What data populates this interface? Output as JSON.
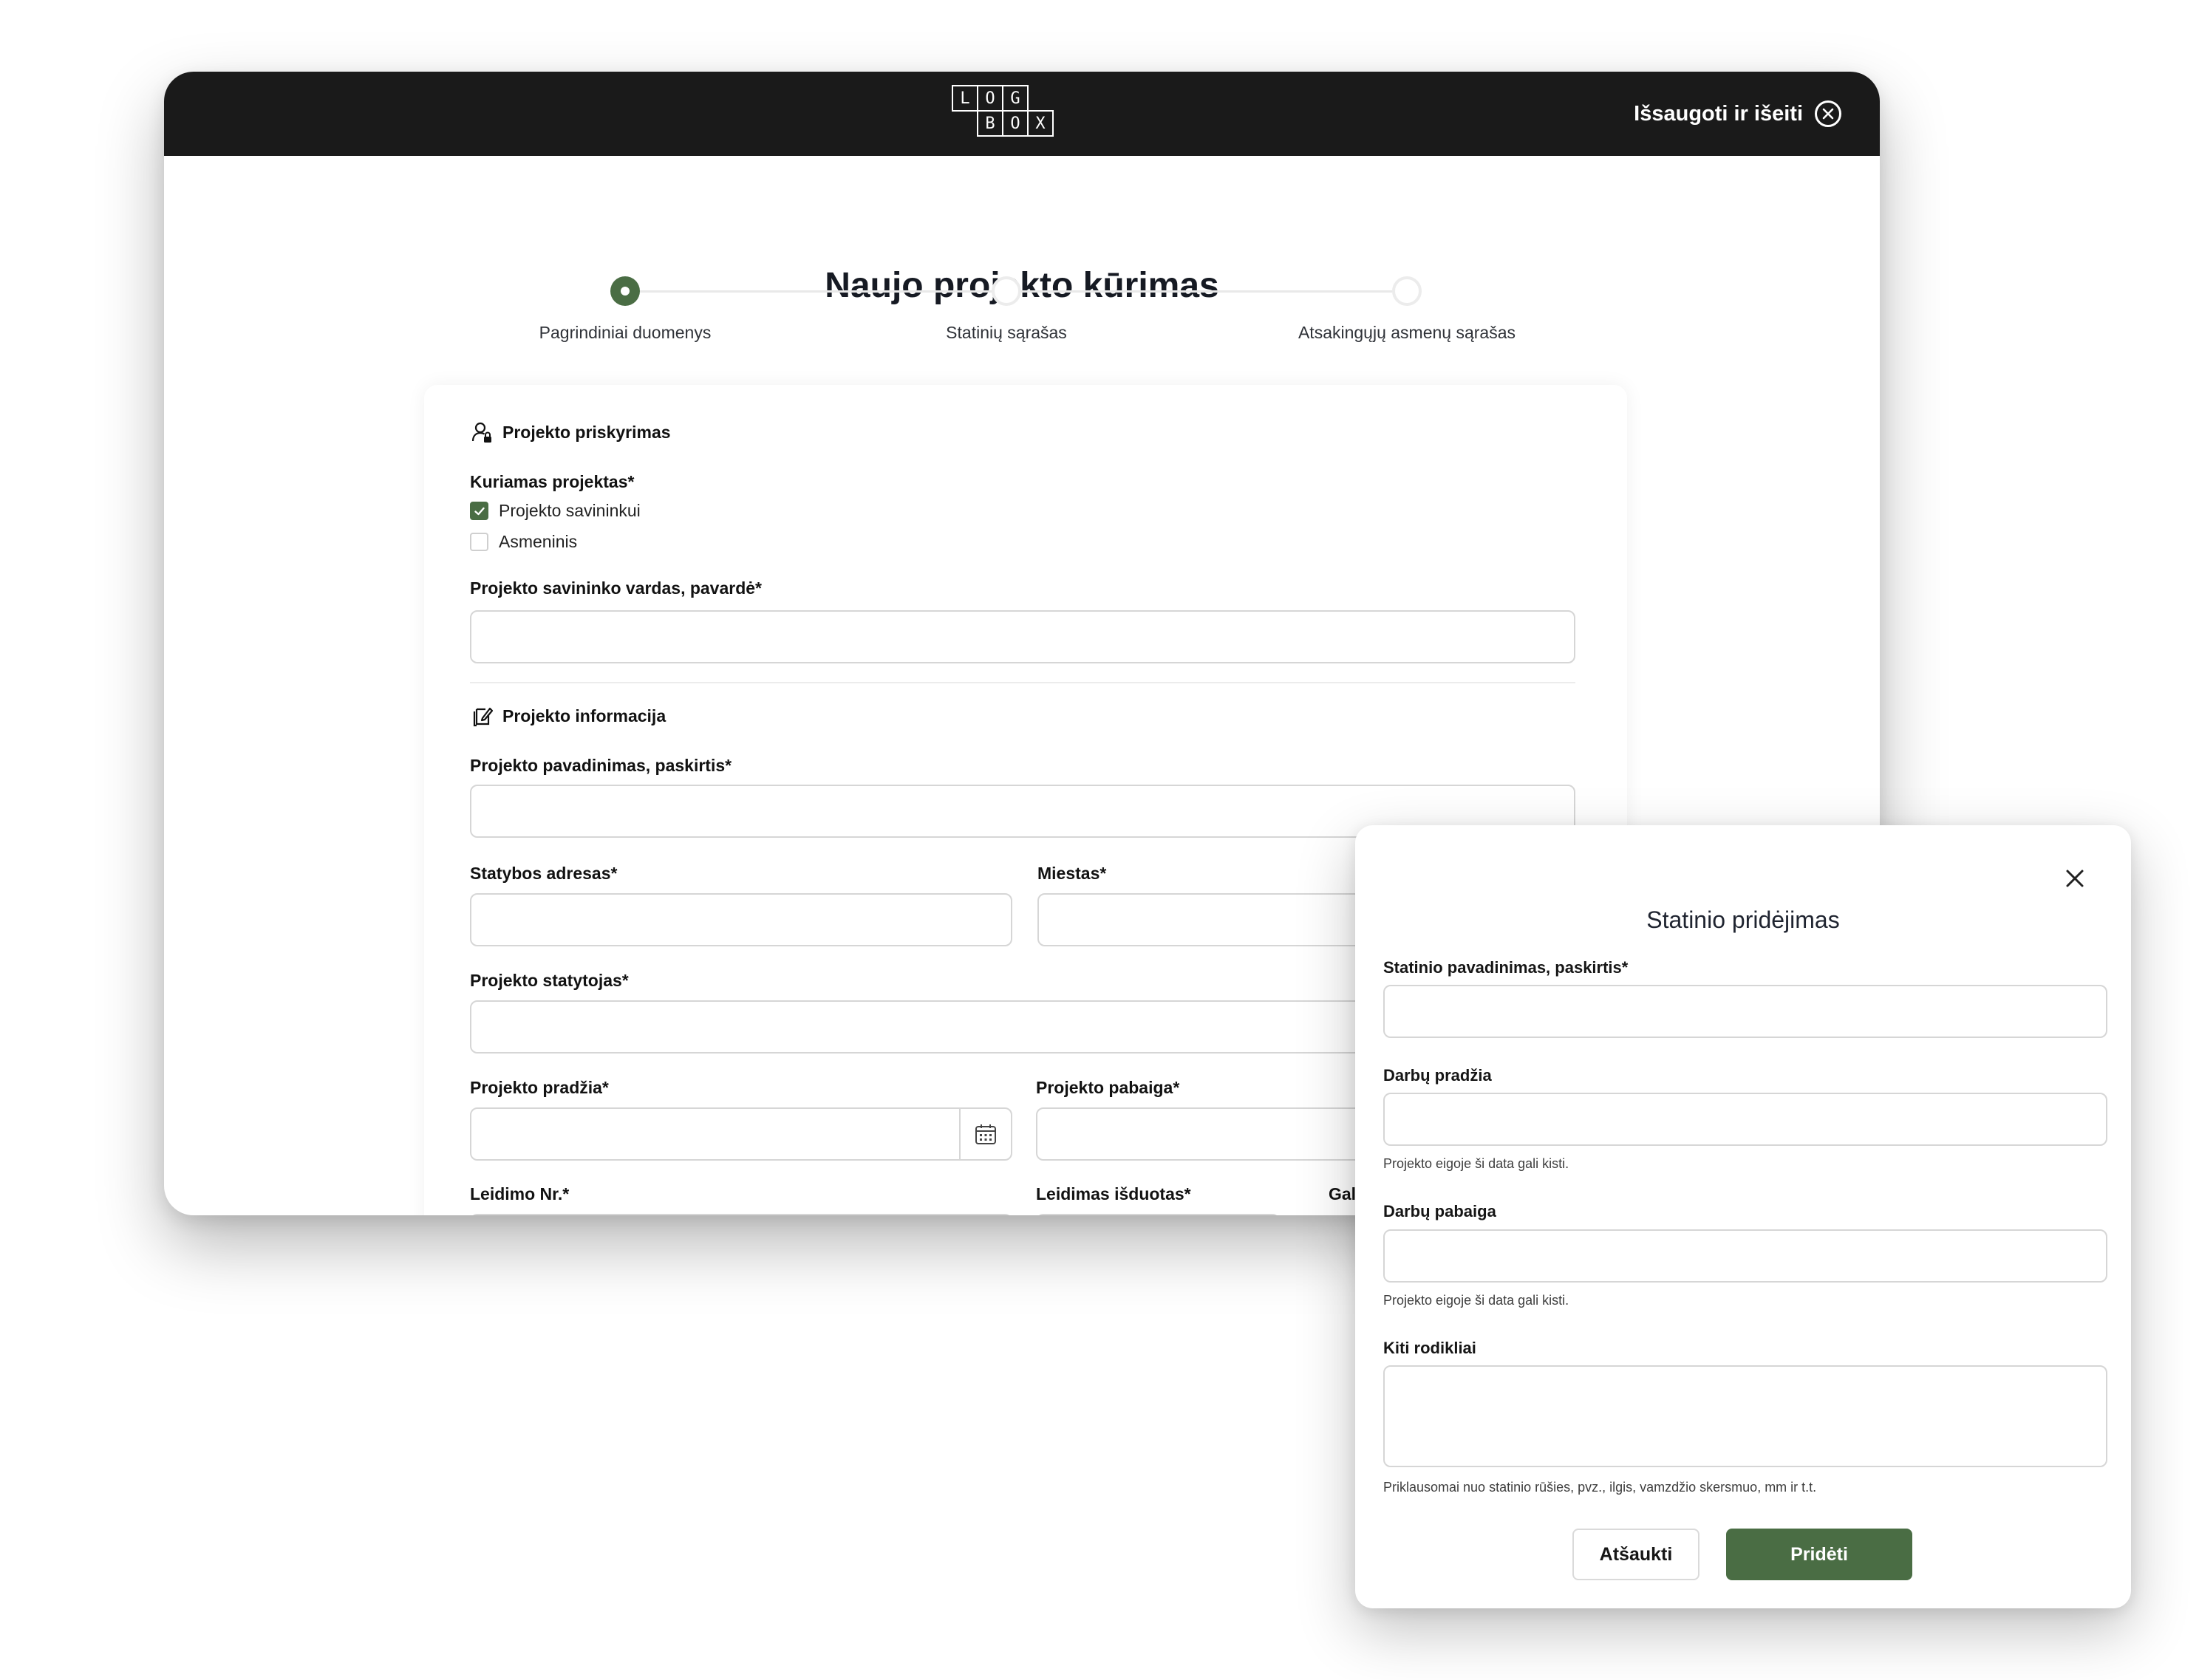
{
  "header": {
    "logo_letters": [
      "L",
      "O",
      "G",
      "B",
      "O",
      "X"
    ],
    "save_exit_label": "Išsaugoti ir išeiti"
  },
  "page": {
    "title": "Naujo projekto kūrimas"
  },
  "stepper": {
    "steps": [
      {
        "label": "Pagrindiniai duomenys",
        "state": "active"
      },
      {
        "label": "Statinių sąrašas",
        "state": "inactive"
      },
      {
        "label": "Atsakingųjų asmenų sąrašas",
        "state": "inactive"
      }
    ]
  },
  "form": {
    "assignment": {
      "section_title": "Projekto priskyrimas",
      "project_type_label": "Kuriamas projektas*",
      "options": [
        {
          "label": "Projekto savininkui",
          "checked": true
        },
        {
          "label": "Asmeninis",
          "checked": false
        }
      ],
      "owner_name_label": "Projekto savininko vardas, pavardė*",
      "owner_name_value": ""
    },
    "info": {
      "section_title": "Projekto informacija",
      "name_label": "Projekto pavadinimas, paskirtis*",
      "address_label": "Statybos adresas*",
      "city_label": "Miestas*",
      "builder_label": "Projekto statytojas*",
      "start_label": "Projekto pradžia*",
      "end_label": "Projekto pabaiga*",
      "permit_no_label": "Leidimo Nr.*",
      "permit_issued_label": "Leidimas išduotas*",
      "partial_label": "Gal"
    }
  },
  "modal": {
    "title": "Statinio pridėjimas",
    "name_label": "Statinio pavadinimas, paskirtis*",
    "works_start_label": "Darbų pradžia",
    "works_start_hint": "Projekto eigoje ši data gali kisti.",
    "works_end_label": "Darbų pabaiga",
    "works_end_hint": "Projekto eigoje ši data gali kisti.",
    "other_label": "Kiti rodikliai",
    "other_hint": "Priklausomai nuo statinio rūšies, pvz., ilgis, vamzdžio skersmuo, mm ir t.t.",
    "cancel_label": "Atšaukti",
    "add_label": "Pridėti"
  },
  "colors": {
    "accent": "#4a6d44",
    "topbar": "#1a1a1a",
    "inactive_step": "#ececec"
  },
  "icons": [
    "close-circle-icon",
    "user-lock-icon",
    "edit-document-icon",
    "calendar-icon",
    "check-icon",
    "close-icon"
  ]
}
